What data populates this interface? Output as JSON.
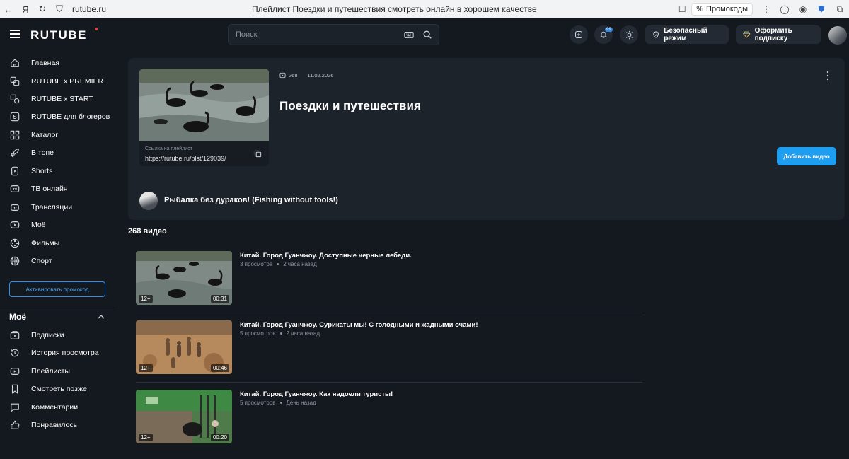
{
  "browser": {
    "url": "rutube.ru",
    "tab_title": "Плейлист Поездки и путешествия смотреть онлайн в хорошем качестве",
    "promo_label": "Промокоды"
  },
  "header": {
    "logo": "RUTUBE",
    "search_placeholder": "Поиск",
    "notifications_count": "99",
    "safe_mode_label": "Безопасный режим",
    "subscribe_label": "Оформить подписку"
  },
  "sidebar": {
    "items": [
      {
        "label": "Главная",
        "icon": "home-icon"
      },
      {
        "label": "RUTUBE x PREMIER",
        "icon": "premier-icon"
      },
      {
        "label": "RUTUBE x START",
        "icon": "start-icon"
      },
      {
        "label": "RUTUBE для блогеров",
        "icon": "blogger-icon"
      },
      {
        "label": "Каталог",
        "icon": "catalog-icon"
      },
      {
        "label": "В топе",
        "icon": "rocket-icon"
      },
      {
        "label": "Shorts",
        "icon": "shorts-icon"
      },
      {
        "label": "ТВ онлайн",
        "icon": "tv-icon"
      },
      {
        "label": "Трансляции",
        "icon": "broadcast-icon"
      },
      {
        "label": "Моё",
        "icon": "my-icon"
      },
      {
        "label": "Фильмы",
        "icon": "films-icon"
      },
      {
        "label": "Спорт",
        "icon": "sport-icon"
      }
    ],
    "promo_button": "Активировать промокод",
    "my_section_title": "Моё",
    "my_items": [
      {
        "label": "Подписки",
        "icon": "subscriptions-icon"
      },
      {
        "label": "История просмотра",
        "icon": "history-icon"
      },
      {
        "label": "Плейлисты",
        "icon": "playlists-icon"
      },
      {
        "label": "Смотреть позже",
        "icon": "bookmark-icon"
      },
      {
        "label": "Комментарии",
        "icon": "comments-icon"
      },
      {
        "label": "Понравилось",
        "icon": "like-icon"
      }
    ]
  },
  "playlist": {
    "video_count_badge": "268",
    "date": "11.02.2026",
    "title": "Поездки и путешествия",
    "link_caption": "Ссылка на плейлист",
    "link": "https://rutube.ru/plst/129039/",
    "add_button": "Добавить видео",
    "author": "Рыбалка без дураков! (Fishing without fools!)",
    "videos_heading": "268 видео"
  },
  "videos": [
    {
      "title": "Китай. Город Гуанчжоу. Доступные черные лебеди.",
      "views": "3 просмотра",
      "time": "2 часа назад",
      "age": "12+",
      "duration": "00:31"
    },
    {
      "title": "Китай. Город Гуанчжоу. Сурикаты мы! С голодными и жадными очами!",
      "views": "5 просмотров",
      "time": "2 часа назад",
      "age": "12+",
      "duration": "00:46"
    },
    {
      "title": "Китай. Город Гуанчжоу. Как надоели туристы!",
      "views": "5 просмотров",
      "time": "День назад",
      "age": "12+",
      "duration": "00:20"
    }
  ],
  "colors": {
    "background": "#14191f",
    "card": "#1d232b",
    "accent": "#1e9ef0"
  }
}
